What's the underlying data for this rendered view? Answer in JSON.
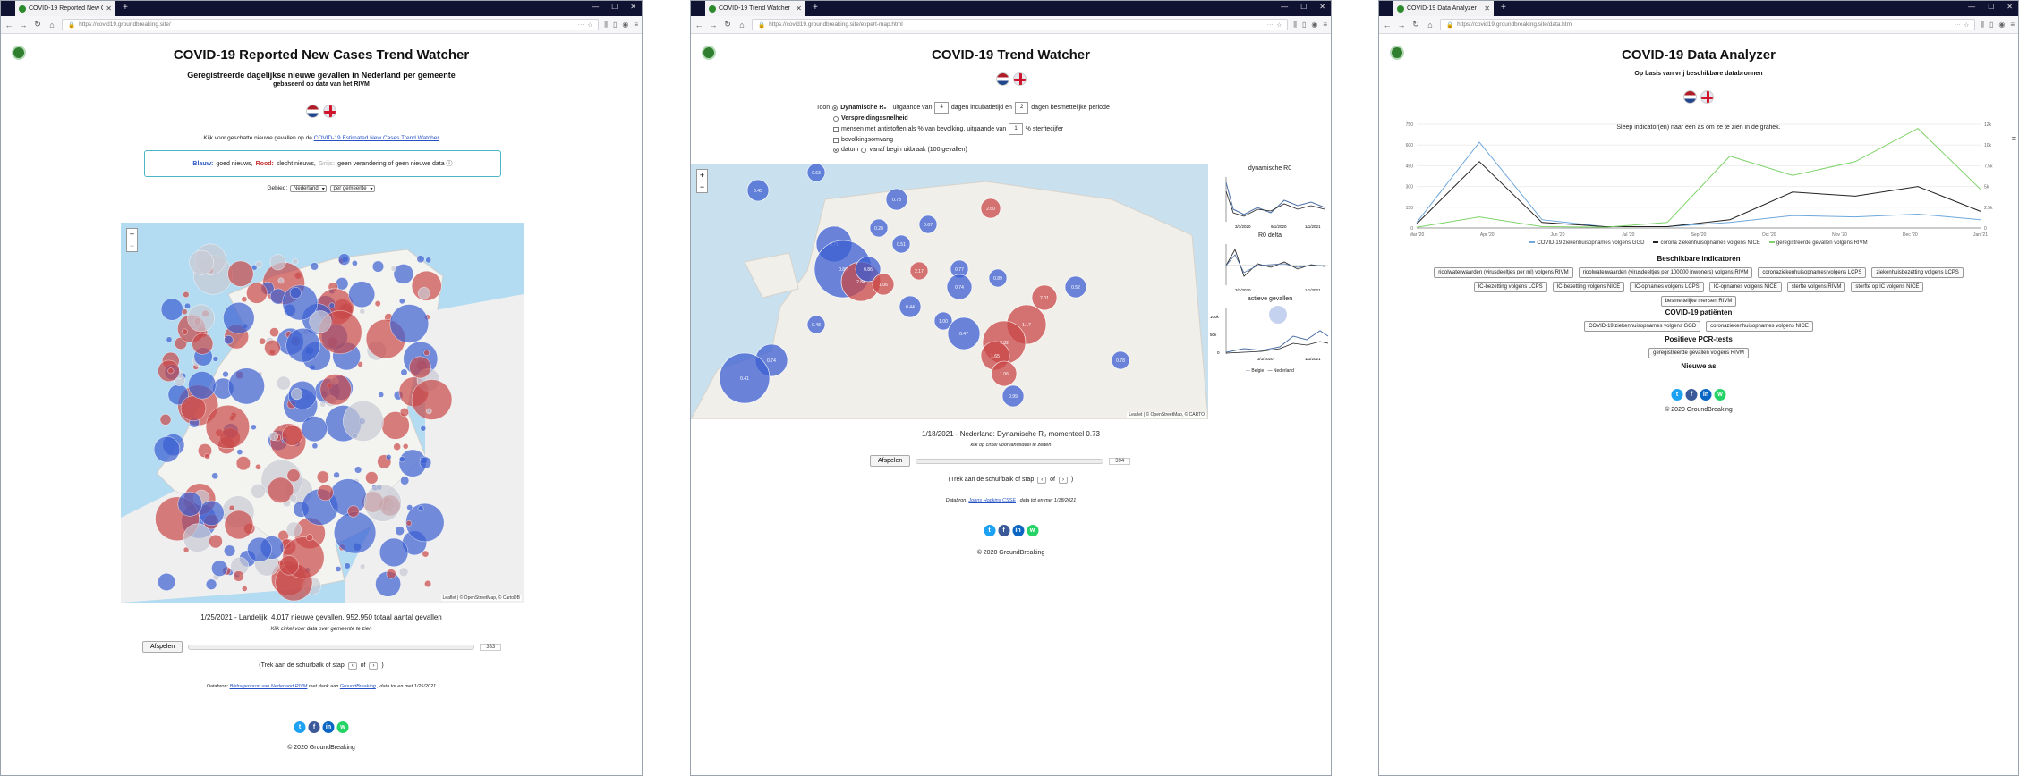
{
  "browser": {
    "new_tab": "+",
    "controls": [
      "—",
      "☐",
      "✕"
    ]
  },
  "window1": {
    "tab_title": "COVID-19 Reported New Cases Tr",
    "url": "https://covid19.groundbreaking.site/",
    "title": "COVID-19 Reported New Cases Trend Watcher",
    "subtitle": "Geregistreerde dagelijkse nieuwe gevallen in Nederland per gemeente",
    "subtitle2": "gebaseerd op data van het RIVM",
    "link_intro": "Kijk voor geschatte nieuwe gevallen op de",
    "link_text": "COVID-19 Estimated New Cases Trend Watcher",
    "legend_blue": "Blauw:",
    "legend_blue_text": "goed nieuws,",
    "legend_red": "Rood:",
    "legend_red_text": "slecht nieuws,",
    "legend_grey": "Grijs:",
    "legend_grey_text": "geen verandering of geen nieuwe data ⓘ",
    "area_label": "Gebied:",
    "area_select_1": "Nederland",
    "area_select_2": "per gemeente",
    "status": "1/25/2021 - Landelijk: 4,017 nieuwe gevallen, 952,950 totaal aantal gevallen",
    "status_note": "Klik cirkel voor data over gemeente te zien",
    "play_label": "Afspelen",
    "slider_value": "333",
    "step_text": "(Trek aan de schuifbalk of stap",
    "step_of": "of",
    "source_text": "Databron:",
    "source_link1": "Bijdragenbron van Nederland RIVM",
    "source_mid": "met dank aan",
    "source_link2": "GroundBreaking",
    "source_end": ", data tot en met 1/25/2021",
    "copyright": "© 2020 GroundBreaking",
    "map_attrib": "Leaflet | © OpenStreetMap, © CartoDB"
  },
  "window2": {
    "tab_title": "COVID-19 Trend Watcher",
    "url": "https://covid19.groundbreaking.site/expert-map.html",
    "title": "COVID-19 Trend Watcher",
    "toon": "Toon",
    "opt1_bold": "Dynamische R₀",
    "opt1_rest": ", uitgaande van",
    "opt1_val1": "4",
    "opt1_mid": "dagen incubatietijd en",
    "opt1_val2": "2",
    "opt1_end": "dagen besmettelijke periode",
    "opt2": "Verspreidingssnelheid",
    "opt3_a": "mensen met antistoffen als % van bevolking, uitgaande van",
    "opt3_val": "1",
    "opt3_b": "% sterftecijfer",
    "opt4": "bevolkingsomvang",
    "opt5_a": "datum",
    "opt5_b": "vanaf begin uitbraak (100 gevallen)",
    "panel1_title": "dynamische R0",
    "panel2_title": "R0 delta",
    "panel3_title": "actieve gevallen",
    "status": "1/18/2021 - Nederland: Dynamische R₀ momenteel 0.73",
    "status_note": "klik op cirkel voor landsdeel te zetten",
    "play_label": "Afspelen",
    "slider_value": "394",
    "step_text": "(Trek aan de schuifbalk of stap",
    "step_of": "of",
    "source_text": "Databron:",
    "source_link": "Johns Hopkins CSSE",
    "source_end": ", data tot en met 1/18/2021",
    "copyright": "© 2020 GroundBreaking",
    "map_attrib": "Leaflet | © OpenStreetMap, © CARTO",
    "bubbles": [
      "0.63",
      "0.45",
      "0.73",
      "0.28",
      "0.67",
      "2.60",
      "0.71",
      "0.51",
      "0.89",
      "2.84",
      "2.17",
      "0.86",
      "1.06",
      "0.77",
      "0.74",
      "0.89",
      "0.52",
      "0.44",
      "0.48",
      "2.01",
      "1.17",
      "1.00",
      "0.47",
      "2.32",
      "1.65",
      "1.06",
      "0.99",
      "0.78",
      "0.74",
      "0.41"
    ],
    "panel_x_labels": [
      "3/1/2020",
      "9/1/2020",
      "1/1/2021"
    ],
    "panel3_y_labels": [
      "100k",
      "50k",
      "0"
    ],
    "panel3_legend": [
      "Belgie",
      "Nederland"
    ]
  },
  "window3": {
    "tab_title": "COVID-19 Data Analyzer",
    "url": "https://covid19.groundbreaking.site/data.html",
    "title": "COVID-19 Data Analyzer",
    "subtitle": "Op basis van vrij beschikbare databronnen",
    "instruction": "Sleep indicator(en) naar een as om ze te zien in de grafiek.",
    "legend": [
      "COVID-19 ziekenhuisopnames volgens GGD",
      "corona ziekenhuisopnames volgens NICE",
      "geregistreerde gevallen volgens RIVM"
    ],
    "sect1": "Beschikbare indicatoren",
    "indicators_row1": [
      "rioolwaterwaarden (virusdeeltjes per ml) volgens RIVM",
      "rioolwaterwaarden (virusdeeltjes per 100000 inwoners) volgens RIVM",
      "coronaziekenhuisopnames volgens LCPS",
      "ziekenhuisbezetting volgens LCPS"
    ],
    "indicators_row2": [
      "IC-bezetting volgens LCPS",
      "IC-bezetting volgens NICE",
      "IC-opnames volgens LCPS",
      "IC-opnames volgens NICE",
      "sterfte volgens RIVM",
      "sterfte op IC volgens NICE"
    ],
    "indicators_row3": [
      "besmettelijke mensen RIVM"
    ],
    "sect2": "COVID-19 patiënten",
    "patients": [
      "COVID-19 ziekenhuisopnames volgens GGD",
      "coronaziekenhuisopnames volgens NICE"
    ],
    "sect3": "Positieve PCR-tests",
    "pcr": [
      "geregistreerde gevallen volgens RIVM"
    ],
    "sect4": "Nieuwe as",
    "copyright": "© 2020 GroundBreaking"
  },
  "chart_data": {
    "type": "line",
    "x": [
      "Mar '20",
      "Apr '20",
      "Jun '20",
      "Jul '20",
      "Sep '20",
      "Oct '20",
      "Nov '20",
      "Dec '20",
      "Jan '21"
    ],
    "y_left_ticks": [
      0,
      150,
      300,
      450,
      600,
      750
    ],
    "y_right_ticks": [
      "0",
      "2.5k",
      "5k",
      "7.5k",
      "10k",
      "12k"
    ],
    "series": [
      {
        "name": "COVID-19 ziekenhuisopnames volgens GGD",
        "color": "#6fa8dc",
        "values": [
          40,
          620,
          60,
          10,
          10,
          40,
          90,
          80,
          100,
          60
        ]
      },
      {
        "name": "corona ziekenhuisopnames volgens NICE",
        "color": "#222222",
        "values": [
          30,
          480,
          40,
          10,
          10,
          60,
          260,
          230,
          300,
          120
        ]
      },
      {
        "name": "geregistreerde gevallen volgens RIVM",
        "color": "#7ed36a",
        "values": [
          5,
          80,
          10,
          5,
          40,
          520,
          380,
          480,
          720,
          280
        ]
      }
    ]
  }
}
